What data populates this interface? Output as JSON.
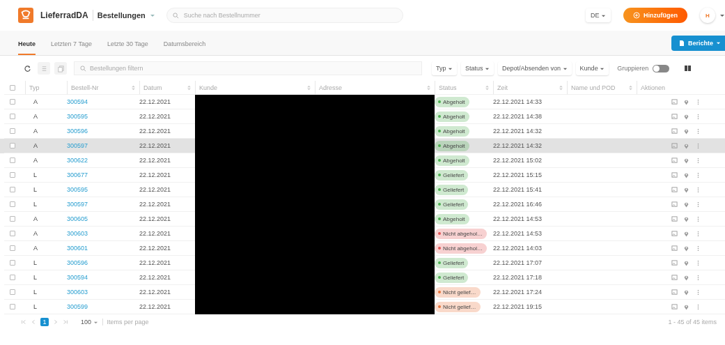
{
  "app": {
    "name": "LieferradDA",
    "section": "Bestellungen",
    "search": {
      "placeholder": "Suche nach Bestellnummer"
    },
    "language": "DE",
    "add_button": "Hinzufügen",
    "avatar": "H"
  },
  "tabs": [
    {
      "label": "Heute",
      "selected": true
    },
    {
      "label": "Letzten 7 Tage",
      "selected": false
    },
    {
      "label": "Letzte 30 Tage",
      "selected": false
    },
    {
      "label": "Datumsbereich",
      "selected": false
    }
  ],
  "report_button": "Berichte",
  "toolbar": {
    "filter": {
      "placeholder": "Bestellungen filtern"
    },
    "filters": [
      "Typ",
      "Status",
      "Depot/Absenden von",
      "Kunde"
    ],
    "group": {
      "label": "Gruppieren",
      "on": false
    }
  },
  "table": {
    "select_all": {
      "checked": false
    },
    "columns": [
      "Typ",
      "Bestell-Nr",
      "Datum",
      "Kunde",
      "Adresse",
      "Status",
      "Zeit",
      "Name und POD",
      "Aktionen"
    ],
    "rows": [
      {
        "checked": false,
        "selected": false,
        "type": "A",
        "order_no": "300594",
        "date": "22.12.2021",
        "status": {
          "label": "Abgeholt",
          "color": "#4caf50"
        },
        "time": "22.12.2021 14:33"
      },
      {
        "checked": false,
        "selected": false,
        "type": "A",
        "order_no": "300595",
        "date": "22.12.2021",
        "status": {
          "label": "Abgeholt",
          "color": "#4caf50"
        },
        "time": "22.12.2021 14:38"
      },
      {
        "checked": false,
        "selected": false,
        "type": "A",
        "order_no": "300596",
        "date": "22.12.2021",
        "status": {
          "label": "Abgeholt",
          "color": "#4caf50"
        },
        "time": "22.12.2021 14:32"
      },
      {
        "checked": false,
        "selected": true,
        "type": "A",
        "order_no": "300597",
        "date": "22.12.2021",
        "status": {
          "label": "Abgeholt",
          "color": "#4caf50"
        },
        "time": "22.12.2021 14:32"
      },
      {
        "checked": false,
        "selected": false,
        "type": "A",
        "order_no": "300622",
        "date": "22.12.2021",
        "status": {
          "label": "Abgeholt",
          "color": "#4caf50"
        },
        "time": "22.12.2021 15:02"
      },
      {
        "checked": false,
        "selected": false,
        "type": "L",
        "order_no": "300677",
        "date": "22.12.2021",
        "status": {
          "label": "Geliefert",
          "color": "#4caf50"
        },
        "time": "22.12.2021 15:15"
      },
      {
        "checked": false,
        "selected": false,
        "type": "L",
        "order_no": "300595",
        "date": "22.12.2021",
        "status": {
          "label": "Geliefert",
          "color": "#4caf50"
        },
        "time": "22.12.2021 15:41"
      },
      {
        "checked": false,
        "selected": false,
        "type": "L",
        "order_no": "300597",
        "date": "22.12.2021",
        "status": {
          "label": "Geliefert",
          "color": "#4caf50"
        },
        "time": "22.12.2021 16:46"
      },
      {
        "checked": false,
        "selected": false,
        "type": "A",
        "order_no": "300605",
        "date": "22.12.2021",
        "status": {
          "label": "Abgeholt",
          "color": "#4caf50"
        },
        "time": "22.12.2021 14:53"
      },
      {
        "checked": false,
        "selected": false,
        "type": "A",
        "order_no": "300603",
        "date": "22.12.2021",
        "status": {
          "label": "Nicht abgehol…",
          "color": "#e05555"
        },
        "time": "22.12.2021 14:53"
      },
      {
        "checked": false,
        "selected": false,
        "type": "A",
        "order_no": "300601",
        "date": "22.12.2021",
        "status": {
          "label": "Nicht abgehol…",
          "color": "#e05555"
        },
        "time": "22.12.2021 14:03"
      },
      {
        "checked": false,
        "selected": false,
        "type": "L",
        "order_no": "300596",
        "date": "22.12.2021",
        "status": {
          "label": "Geliefert",
          "color": "#4caf50"
        },
        "time": "22.12.2021 17:07"
      },
      {
        "checked": false,
        "selected": false,
        "type": "L",
        "order_no": "300594",
        "date": "22.12.2021",
        "status": {
          "label": "Geliefert",
          "color": "#4caf50"
        },
        "time": "22.12.2021 17:18"
      },
      {
        "checked": false,
        "selected": false,
        "type": "L",
        "order_no": "300603",
        "date": "22.12.2021",
        "status": {
          "label": "Nicht gelief…",
          "color": "#e8743a"
        },
        "time": "22.12.2021 17:24"
      },
      {
        "checked": false,
        "selected": false,
        "type": "L",
        "order_no": "300599",
        "date": "22.12.2021",
        "status": {
          "label": "Nicht gelief…",
          "color": "#e8743a"
        },
        "time": "22.12.2021 19:15"
      }
    ]
  },
  "pagination": {
    "pages": [
      {
        "label": "1",
        "selected": true
      }
    ],
    "page_size": "100",
    "page_size_label": "Items per page",
    "summary": "1 - 45 of 45 items"
  }
}
